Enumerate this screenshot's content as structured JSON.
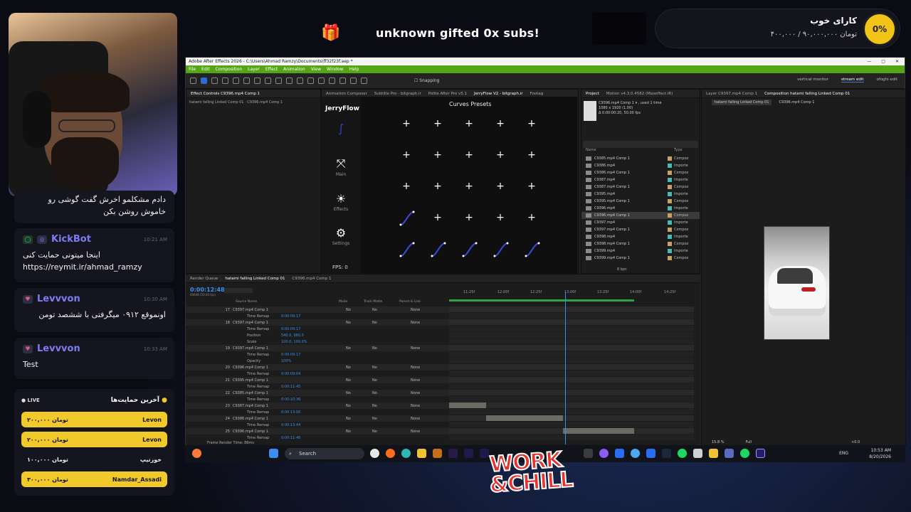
{
  "overlay": {
    "gift_text": "unknown gifted 0x subs!",
    "goal_title": "کارای خوب",
    "goal_amount": "۴۰۰,۰۰۰ / ۹۰,۰۰۰,۰۰۰ تومان",
    "goal_percent": "0%",
    "brand_color": "#f2c418"
  },
  "chat": [
    {
      "name": "",
      "time": "",
      "text": "دادم مشکلمو اخرش گفت گوشی رو خاموش روشن بکن"
    },
    {
      "name": "KickBot",
      "time": "10:21 AM",
      "text": "اینجا میتونی حمایت کنی https://reymit.ir/ahmad_ramzy"
    },
    {
      "name": "Levvvon",
      "time": "10:30 AM",
      "text": "اونموقع ۰۹۱۲ میگرفتی با ششصد تومن"
    },
    {
      "name": "Levvvon",
      "time": "10:33 AM",
      "text": "Test"
    }
  ],
  "donations": {
    "live": "LIVE",
    "title": "آخرین حمایت‌ها",
    "rows": [
      {
        "name": "Levon",
        "amount": "۲۰۰,۰۰۰ تومان"
      },
      {
        "name": "Levon",
        "amount": "۲۰۰,۰۰۰ تومان"
      },
      {
        "name": "خوزتیپ",
        "amount": "۱۰۰,۰۰۰ تومان"
      },
      {
        "name": "Namdar_Assadi",
        "amount": "۳۰۰,۰۰۰ تومان"
      }
    ]
  },
  "ae": {
    "title": "Adobe After Effects 2026 - C:\\Users\\Ahmad Ramzy\\Documents\\ff32f23f.aep *",
    "menu": [
      "File",
      "Edit",
      "Composition",
      "Layer",
      "Effect",
      "Animation",
      "View",
      "Window",
      "Help"
    ],
    "snapping": "Snapping",
    "workspaces": [
      "vertical monitor",
      "stream edit",
      "ofoghi edit"
    ],
    "effect_controls_tab": "Effect Controls C9396.mp4 Comp 1",
    "effect_controls_sub": "hatami falling Linked Comp 01 · C9396.mp4 Comp 1",
    "ext_tabs": [
      "Animation Composer",
      "Subtitle Pro - bitgraph.ir",
      "Polite After Pro v5.1",
      "JerryFlow V2 - bitgraph.ir",
      "Footag"
    ],
    "jerryflow": {
      "logo": "JerryFlow",
      "curves_title": "Curves Presets",
      "nav": [
        "Main",
        "Effects",
        "Settings"
      ],
      "fps": "FPS: 0"
    },
    "project": {
      "tab": "Project",
      "tab2": "Motion v4.3.0.4582 (Maxeffect.IR)",
      "info": "C9396.mp4 Comp 1 ▾ , used 1 time",
      "info2": "1080 x 1920 (1.00)",
      "info3": "Δ 0:00:00:20, 50.00 fps",
      "col_name": "Name",
      "col_type": "Type",
      "items": [
        {
          "name": "C9385.mp4 Comp 1",
          "type": "Compos"
        },
        {
          "name": "C9386.mp4",
          "type": "Importe"
        },
        {
          "name": "C9386.mp4 Comp 1",
          "type": "Compos"
        },
        {
          "name": "C9387.mp4",
          "type": "Importe"
        },
        {
          "name": "C9387.mp4 Comp 1",
          "type": "Compos"
        },
        {
          "name": "C9395.mp4",
          "type": "Importe"
        },
        {
          "name": "C9395.mp4 Comp 1",
          "type": "Compos"
        },
        {
          "name": "C9396.mp4",
          "type": "Importe"
        },
        {
          "name": "C9396.mp4 Comp 1",
          "type": "Compos"
        },
        {
          "name": "C9397.mp4",
          "type": "Importe"
        },
        {
          "name": "C9397.mp4 Comp 1",
          "type": "Compos"
        },
        {
          "name": "C9398.mp4",
          "type": "Importe"
        },
        {
          "name": "C9398.mp4 Comp 1",
          "type": "Compos"
        },
        {
          "name": "C9399.mp4",
          "type": "Importe"
        },
        {
          "name": "C9399.mp4 Comp 1",
          "type": "Compos"
        }
      ],
      "bpc": "8 bpc"
    },
    "comp": {
      "tab": "Layer C9397.mp4 Comp 1",
      "tab2": "Composition hatami falling Linked Comp 01",
      "sub": "hatami falling Linked Comp 01",
      "sub2": "C9396.mp4 Comp 1",
      "zoom": "15.8 %",
      "res": "Full",
      "exposure": "+0.0"
    },
    "timeline": {
      "tabs": [
        "Render Queue",
        "hatami falling Linked Comp 01",
        "C9396.mp4 Comp 1"
      ],
      "time": "0:00:12:48",
      "fps_note": "00648 (50.00 fps)",
      "col_source": "Source Name",
      "col_mode": "Mode",
      "col_track": "Track Matte",
      "col_parent": "Parent & Link",
      "ruler": [
        "11:25f",
        "12:00f",
        "12:25f",
        "13:00f",
        "13:25f",
        "14:00f",
        "14:25f"
      ],
      "layers": [
        {
          "num": "17",
          "name": "C9397.mp4 Comp 1",
          "kind": "main"
        },
        {
          "num": "",
          "name": "Time Remap",
          "val": "0:00:09:17",
          "kind": "sub"
        },
        {
          "num": "18",
          "name": "C9397.mp4 Comp 1",
          "kind": "main"
        },
        {
          "num": "",
          "name": "Time Remap",
          "val": "0:00:09:17",
          "kind": "sub"
        },
        {
          "num": "",
          "name": "Position",
          "val": "540.0, 960.0",
          "kind": "sub"
        },
        {
          "num": "",
          "name": "Scale",
          "val": "100.0, 100.0%",
          "kind": "sub"
        },
        {
          "num": "19",
          "name": "C9397.mp4 Comp 1",
          "kind": "main"
        },
        {
          "num": "",
          "name": "Time Remap",
          "val": "0:00:09:17",
          "kind": "sub"
        },
        {
          "num": "",
          "name": "Opacity",
          "val": "100%",
          "kind": "sub"
        },
        {
          "num": "20",
          "name": "C9396.mp4 Comp 1",
          "kind": "main"
        },
        {
          "num": "",
          "name": "Time Remap",
          "val": "0:00:09:04",
          "kind": "sub"
        },
        {
          "num": "21",
          "name": "C9395.mp4 Comp 1",
          "kind": "main"
        },
        {
          "num": "",
          "name": "Time Remap",
          "val": "0:00:11:45",
          "kind": "sub"
        },
        {
          "num": "22",
          "name": "C9385.mp4 Comp 1",
          "kind": "main"
        },
        {
          "num": "",
          "name": "Time Remap",
          "val": "0:00:10:36",
          "kind": "sub"
        },
        {
          "num": "23",
          "name": "C9387.mp4 Comp 1",
          "kind": "main"
        },
        {
          "num": "",
          "name": "Time Remap",
          "val": "0:00:13:00",
          "kind": "sub"
        },
        {
          "num": "24",
          "name": "C9386.mp4 Comp 1",
          "kind": "main"
        },
        {
          "num": "",
          "name": "Time Remap",
          "val": "0:00:13:44",
          "kind": "sub"
        },
        {
          "num": "25",
          "name": "C9396.mp4 Comp 1",
          "kind": "main"
        },
        {
          "num": "",
          "name": "Time Remap",
          "val": "0:00:11:46",
          "kind": "sub"
        }
      ],
      "mode_value": "No",
      "parent_value": "None",
      "render_time": "Frame Render Time: 86ms"
    }
  },
  "taskbar": {
    "search": "Search",
    "lang": "ENG",
    "time": "10:53 AM",
    "date": "8/20/2026"
  },
  "logo": {
    "line1": "WORK",
    "line2": "&CHILL"
  }
}
